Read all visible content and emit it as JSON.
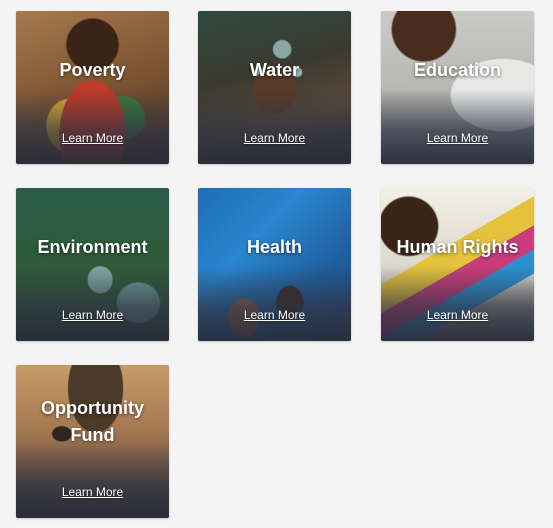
{
  "tiles": [
    {
      "key": "poverty",
      "title": "Poverty",
      "link": "Learn More"
    },
    {
      "key": "water",
      "title": "Water",
      "link": "Learn More"
    },
    {
      "key": "education",
      "title": "Education",
      "link": "Learn More"
    },
    {
      "key": "environment",
      "title": "Environment",
      "link": "Learn More"
    },
    {
      "key": "health",
      "title": "Health",
      "link": "Learn More"
    },
    {
      "key": "human-rights",
      "title": "Human Rights",
      "link": "Learn More"
    },
    {
      "key": "opportunity-fund",
      "title": "Opportunity\nFund",
      "link": "Learn More"
    }
  ]
}
